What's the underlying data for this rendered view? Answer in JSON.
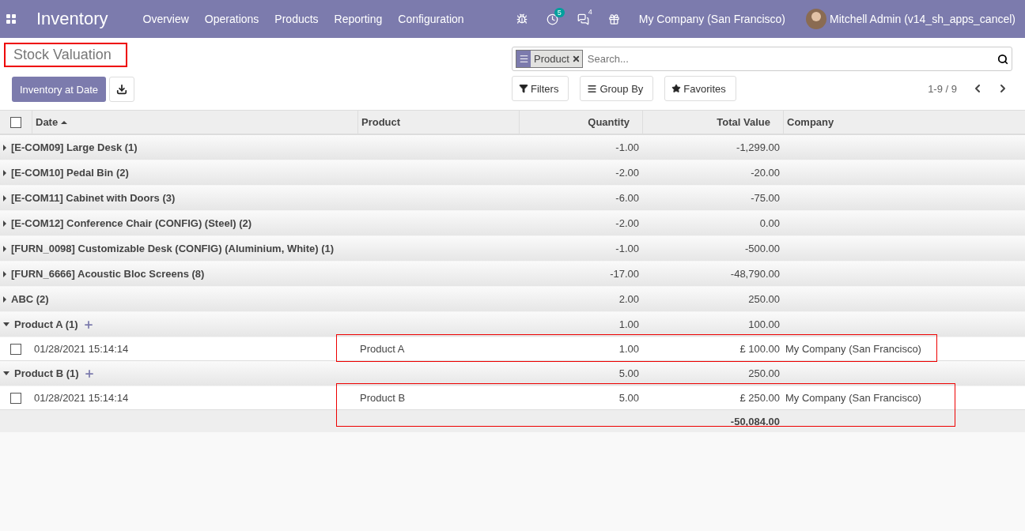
{
  "navbar": {
    "app_name": "Inventory",
    "menu": [
      "Overview",
      "Operations",
      "Products",
      "Reporting",
      "Configuration"
    ],
    "activity_count": "5",
    "message_count": "4",
    "company": "My Company (San Francisco)",
    "user": "Mitchell Admin (v14_sh_apps_cancel)"
  },
  "control_panel": {
    "title": "Stock Valuation",
    "title_highlighted": true,
    "primary_button": "Inventory at Date",
    "facet": "Product",
    "search_placeholder": "Search...",
    "filters": "Filters",
    "group_by": "Group By",
    "favorites": "Favorites",
    "pager": "1-9 / 9"
  },
  "table": {
    "select_all_checked": false,
    "columns": [
      {
        "label": "Date",
        "sorted": true
      },
      {
        "label": "Product",
        "sorted": false
      },
      {
        "label": "Quantity",
        "sorted": false
      },
      {
        "label": "Total Value",
        "sorted": false
      },
      {
        "label": "Company",
        "sorted": false
      }
    ],
    "groups": [
      {
        "label": "[E-COM09] Large Desk (1)",
        "quantity": "-1.00",
        "total": "-1,299.00",
        "expanded": false
      },
      {
        "label": "[E-COM10] Pedal Bin (2)",
        "quantity": "-2.00",
        "total": "-20.00",
        "expanded": false
      },
      {
        "label": "[E-COM11] Cabinet with Doors (3)",
        "quantity": "-6.00",
        "total": "-75.00",
        "expanded": false
      },
      {
        "label": "[E-COM12] Conference Chair (CONFIG) (Steel) (2)",
        "quantity": "-2.00",
        "total": "0.00",
        "expanded": false
      },
      {
        "label": "[FURN_0098] Customizable Desk (CONFIG) (Aluminium, White) (1)",
        "quantity": "-1.00",
        "total": "-500.00",
        "expanded": false
      },
      {
        "label": "[FURN_6666] Acoustic Bloc Screens (8)",
        "quantity": "-17.00",
        "total": "-48,790.00",
        "expanded": false
      },
      {
        "label": "ABC (2)",
        "quantity": "2.00",
        "total": "250.00",
        "expanded": false
      },
      {
        "label": "Product A (1)",
        "quantity": "1.00",
        "total": "100.00",
        "expanded": true,
        "records": [
          {
            "date": "01/28/2021 15:14:14",
            "product": "Product A",
            "quantity": "1.00",
            "total": "£ 100.00",
            "company": "My Company (San Francisco)",
            "checked": false,
            "highlighted": true
          }
        ]
      },
      {
        "label": "Product B (1)",
        "quantity": "5.00",
        "total": "250.00",
        "expanded": true,
        "records": [
          {
            "date": "01/28/2021 15:14:14",
            "product": "Product B",
            "quantity": "5.00",
            "total": "£ 250.00",
            "company": "My Company (San Francisco)",
            "checked": false,
            "highlighted": true
          }
        ]
      }
    ],
    "grand_total": "-50,084.00",
    "grand_total_highlighted": true
  }
}
